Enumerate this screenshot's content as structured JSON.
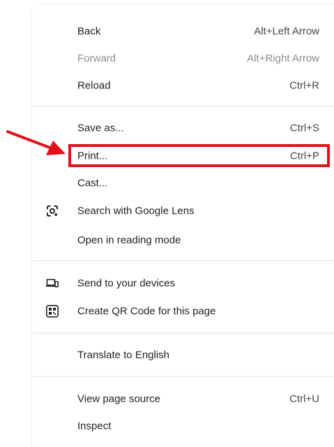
{
  "menu": {
    "items": [
      {
        "label": "Back",
        "shortcut": "Alt+Left Arrow"
      },
      {
        "label": "Forward",
        "shortcut": "Alt+Right Arrow",
        "disabled": true
      },
      {
        "label": "Reload",
        "shortcut": "Ctrl+R"
      },
      {
        "label": "Save as...",
        "shortcut": "Ctrl+S"
      },
      {
        "label": "Print...",
        "shortcut": "Ctrl+P"
      },
      {
        "label": "Cast..."
      },
      {
        "label": "Search with Google Lens",
        "icon": "google-lens-icon"
      },
      {
        "label": "Open in reading mode"
      },
      {
        "label": "Send to your devices",
        "icon": "devices-icon"
      },
      {
        "label": "Create QR Code for this page",
        "icon": "qr-code-icon"
      },
      {
        "label": "Translate to English"
      },
      {
        "label": "View page source",
        "shortcut": "Ctrl+U"
      },
      {
        "label": "Inspect"
      }
    ]
  },
  "annotation": {
    "arrow_color": "#e0111a",
    "highlight_color": "#e0111a"
  }
}
